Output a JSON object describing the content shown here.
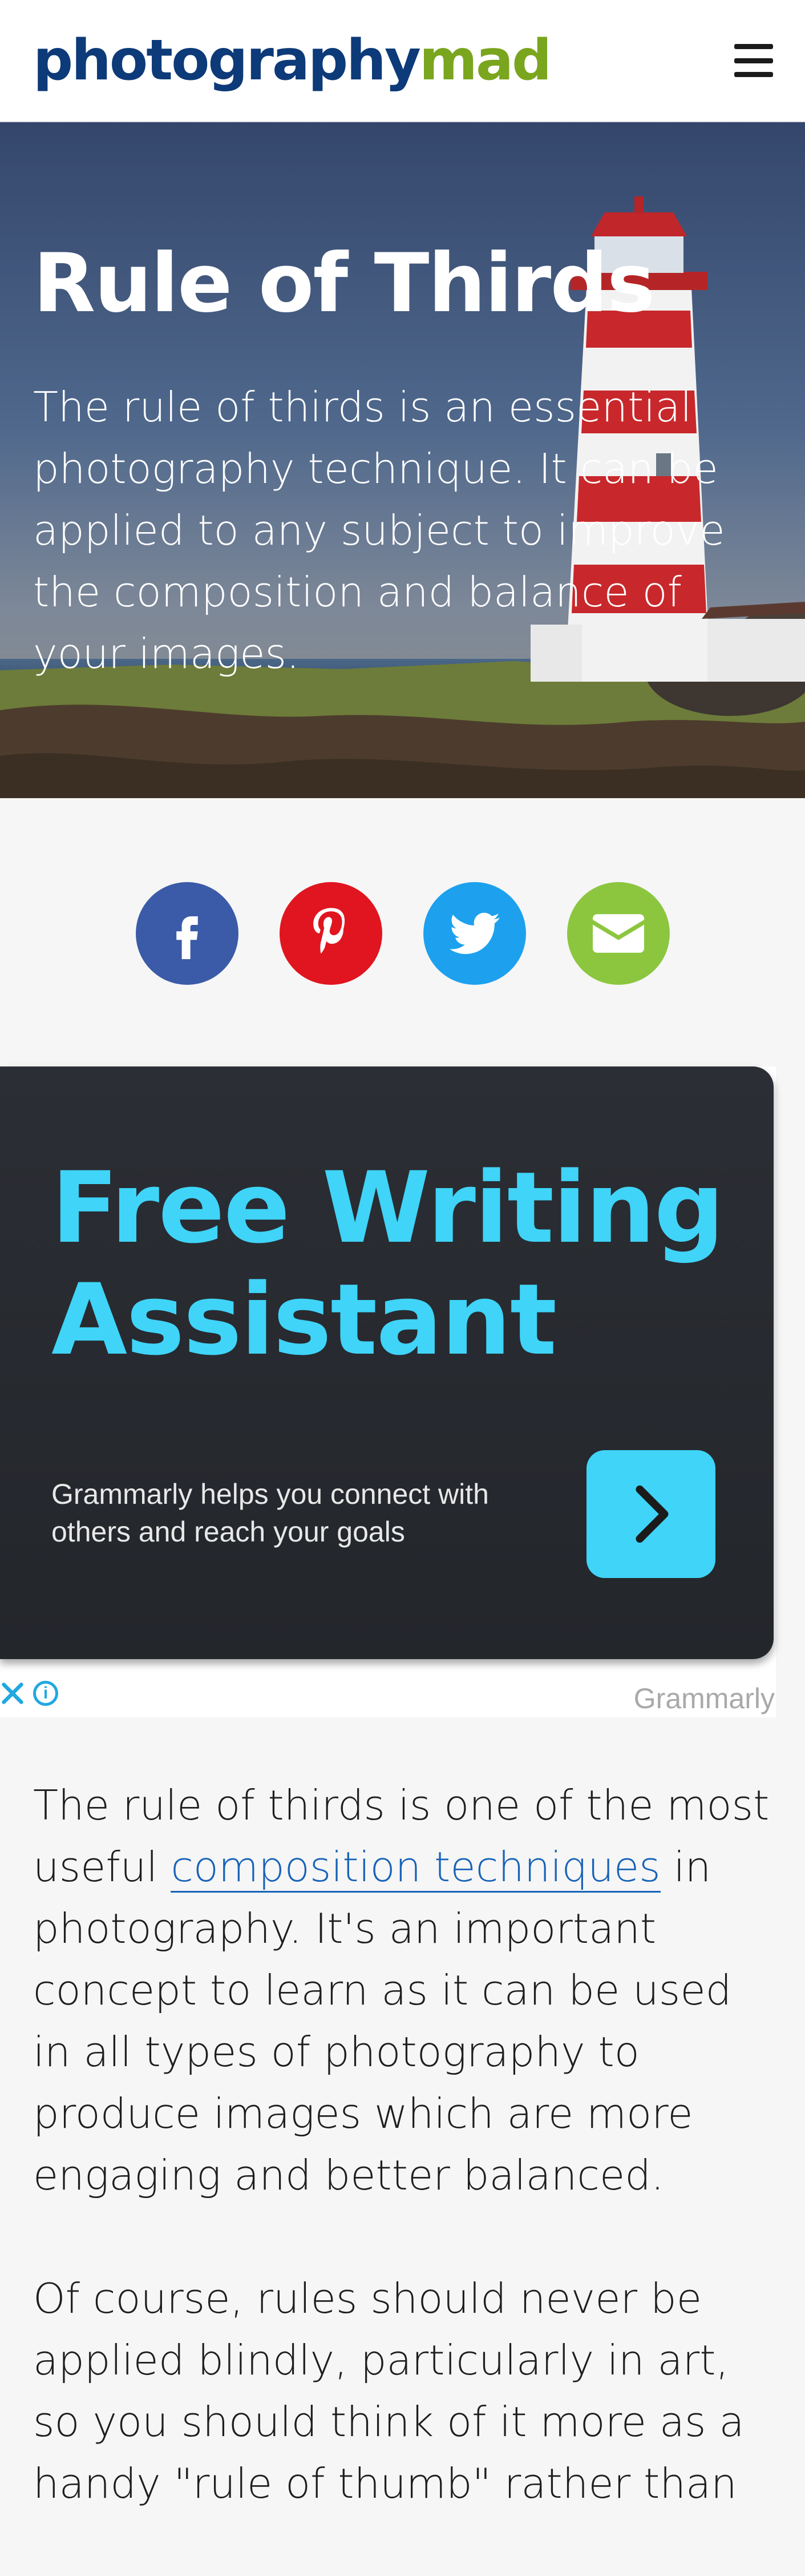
{
  "header": {
    "logo_part1": "photography",
    "logo_part2": "mad",
    "menu_icon": "hamburger-icon",
    "colors": {
      "logo_primary": "#0d3a78",
      "logo_accent": "#7aa51e"
    }
  },
  "hero": {
    "title": "Rule of Thirds",
    "subtitle": "The rule of thirds is an essential photography technique. It can be applied to any subject to improve the composition and balance of your images."
  },
  "share": {
    "buttons": [
      {
        "icon": "facebook-icon",
        "color": "#3b5ba8"
      },
      {
        "icon": "pinterest-icon",
        "color": "#e0151f"
      },
      {
        "icon": "twitter-icon",
        "color": "#1da1ee"
      },
      {
        "icon": "email-icon",
        "color": "#8cc63f"
      }
    ]
  },
  "ad": {
    "title_line1": "Free Writing",
    "title_line2": "Assistant",
    "subtitle": "Grammarly helps you connect with others and reach your goals",
    "brand": "Grammarly",
    "cta_icon": "chevron-right-icon",
    "close_icon": "close-icon",
    "info_icon": "info-icon",
    "info_glyph": "i",
    "colors": {
      "accent": "#3fd4f8",
      "background": "#2b2e34"
    }
  },
  "article": {
    "p1_before": "The rule of thirds is one of the most useful ",
    "p1_link": "composition techniques",
    "p1_after": " in photography. It's an important concept to learn as it can be used in all types of photography to produce images which are more engaging and better balanced.",
    "p2": "Of course, rules should never be applied blindly, particularly in art, so you should think of it more as a handy \"rule of thumb\" rather than"
  }
}
